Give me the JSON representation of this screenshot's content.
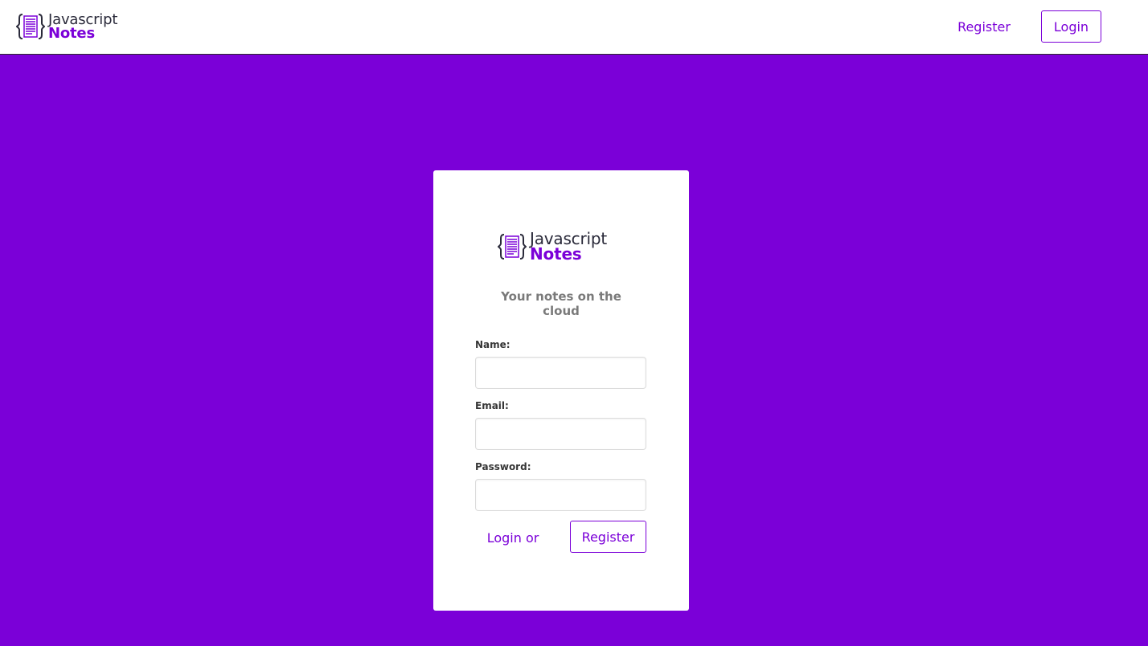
{
  "colors": {
    "brand_purple": "#7b00d8",
    "page_background": "#7b00d8",
    "card_background": "#ffffff",
    "subtitle_gray": "#7a7a7a"
  },
  "navbar": {
    "logo": {
      "icon": "notes-braces-icon",
      "line1": "Javascript",
      "line2": "Notes"
    },
    "register_label": "Register",
    "login_label": "Login"
  },
  "card": {
    "logo": {
      "icon": "notes-braces-icon",
      "line1": "Javascript",
      "line2": "Notes"
    },
    "subtitle": "Your notes on the cloud",
    "form": {
      "name_label": "Name:",
      "name_value": "",
      "email_label": "Email:",
      "email_value": "",
      "password_label": "Password:",
      "password_value": "",
      "login_link": "Login or",
      "register_button": "Register"
    }
  }
}
